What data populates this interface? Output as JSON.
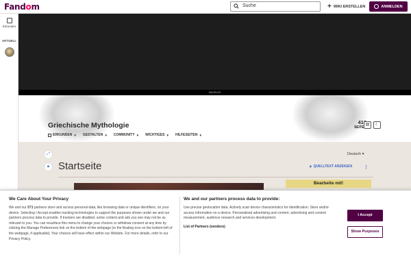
{
  "topbar": {
    "logo_prefix": "Fand",
    "logo_flame": "o",
    "logo_suffix": "m",
    "search_placeholder": "Suche",
    "create_wiki_label": "WIKI ERSTELLEN",
    "login_label": "ANMELDEN"
  },
  "rail": {
    "explore_label": "Erkunden",
    "recent_label": "AKTUELL"
  },
  "ad": {
    "label": "ANZEIGE"
  },
  "wiki": {
    "title": "Griechische Mythologie",
    "nav": [
      {
        "label": "ERKUNDEN"
      },
      {
        "label": "GESTALTEN"
      },
      {
        "label": "COMMUNITY"
      },
      {
        "label": "WICHTIGES"
      },
      {
        "label": "HILFESEITEN"
      }
    ],
    "pages_count": "410",
    "pages_label": "SEITEN"
  },
  "page": {
    "language": "Deutsch",
    "title": "Startseite",
    "source_label": "QUELLTEXT ANZEIGEN",
    "edit_box_label": "Bearbeite mit!"
  },
  "consent": {
    "left_title": "We Care About Your Privacy",
    "left_body_1": "We and our ",
    "partners_count": "571",
    "left_body_2": " partners store and access personal data, like browsing data or unique identifiers, on your device. Selecting I Accept enables tracking technologies to support the purposes shown under we and our partners process data to provide. If trackers are disabled, some content and ads you see may not be as relevant to you. You can resurface this menu to change your choices or withdraw consent at any time by clicking the Manage Preferences link on the bottom of the webpage [or the floating icon on the bottom-left of the webpage, if applicable]. Your choices will have effect within our Website. For more details, refer to our Privacy Policy.",
    "right_title": "We and our partners process data to provide:",
    "right_body": "Use precise geolocation data. Actively scan device characteristics for identification. Store and/or access information on a device. Personalised advertising and content, advertising and content measurement, audience research and services development.",
    "partners_link": "List of Partners (vendors)",
    "accept_label": "I Accept",
    "purposes_label": "Show Purposes"
  },
  "colors": {
    "brand": "#520044",
    "flame": "#fa005a",
    "link": "#3a66c8",
    "edit_box": "#e7d784"
  }
}
